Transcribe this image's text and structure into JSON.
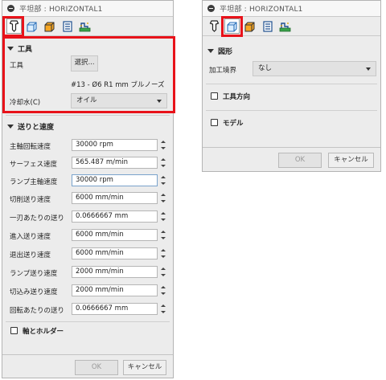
{
  "left": {
    "title": "平坦部 : HORIZONTAL1",
    "tool_section": {
      "title": "工具",
      "tool_label": "工具",
      "select_button": "選択...",
      "tool_description": "#13 - Ø6 R1 mm ブルノーズ",
      "coolant_label": "冷却水(C)",
      "coolant_value": "オイル"
    },
    "feeds_section": {
      "title": "送りと速度",
      "rows": [
        {
          "label": "主軸回転速度",
          "value": "30000 rpm"
        },
        {
          "label": "サーフェス速度",
          "value": "565.487 m/min"
        },
        {
          "label": "ランプ主軸速度",
          "value": "30000 rpm"
        },
        {
          "label": "切削送り速度",
          "value": "6000 mm/min"
        },
        {
          "label": "一刃あたりの送り",
          "value": "0.0666667 mm"
        },
        {
          "label": "進入送り速度",
          "value": "6000 mm/min"
        },
        {
          "label": "退出送り速度",
          "value": "6000 mm/min"
        },
        {
          "label": "ランプ送り速度",
          "value": "2000 mm/min"
        },
        {
          "label": "切込み送り速度",
          "value": "2000 mm/min"
        },
        {
          "label": "回転あたりの送り",
          "value": "0.0666667 mm"
        }
      ]
    },
    "shaft_holder_label": "軸とホルダー",
    "ok_label": "OK",
    "cancel_label": "キャンセル"
  },
  "right": {
    "title": "平坦部 : HORIZONTAL1",
    "geometry_section": {
      "title": "図形",
      "machining_boundary_label": "加工境界",
      "machining_boundary_value": "なし"
    },
    "tool_orientation_label": "工具方向",
    "model_label": "モデル",
    "ok_label": "OK",
    "cancel_label": "キャンセル"
  },
  "highlight_color": "#e8121a"
}
